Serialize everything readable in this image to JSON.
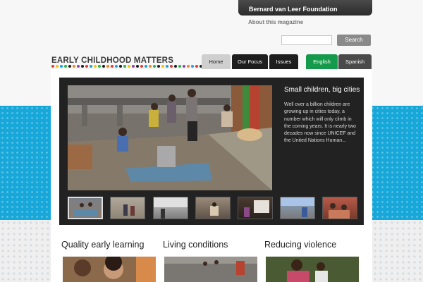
{
  "header": {
    "foundation_tab": "Bernard van Leer Foundation",
    "about_link": "About this magazine"
  },
  "search": {
    "placeholder": "",
    "button_label": "Search"
  },
  "logo": {
    "text": "EARLY CHILDHOOD MATTERS",
    "dot_colors": [
      "#e53935",
      "#f4c20d",
      "#1aa3dd",
      "#2bb34a",
      "#1e1e1e",
      "#f08a24",
      "#8e44ad",
      "#1e1e1e",
      "#e53935",
      "#1aa3dd",
      "#f4c20d",
      "#2bb34a",
      "#1e1e1e",
      "#f08a24",
      "#e53935",
      "#1aa3dd",
      "#1e1e1e",
      "#2bb34a",
      "#f4c20d",
      "#8e44ad",
      "#1e1e1e",
      "#e53935",
      "#1aa3dd",
      "#f08a24",
      "#2bb34a",
      "#1e1e1e",
      "#f4c20d",
      "#1aa3dd",
      "#e53935",
      "#1e1e1e",
      "#2bb34a",
      "#8e44ad",
      "#f08a24",
      "#1aa3dd",
      "#e53935",
      "#1e1e1e",
      "#1e1e1e"
    ]
  },
  "nav": {
    "home": "Home",
    "our_focus": "Our Focus",
    "issues": "Issues"
  },
  "language": {
    "english": "English",
    "spanish": "Spanish"
  },
  "feature": {
    "title": "Small children, big cities",
    "text": "Well over a billion children are growing up in cities today, a number which will only climb in the coming years. It is nearly two decades now since UNICEF and the United Nations Human..."
  },
  "thumbnails": [
    "thumb-1",
    "thumb-2",
    "thumb-3",
    "thumb-4",
    "thumb-5",
    "thumb-6",
    "thumb-7"
  ],
  "sections": [
    {
      "title": "Quality early learning"
    },
    {
      "title": "Living conditions"
    },
    {
      "title": "Reducing violence"
    }
  ],
  "colors": {
    "blue_band": "#17a7d9",
    "language_active": "#159a4b",
    "nav_dark": "#1e1e1e"
  }
}
